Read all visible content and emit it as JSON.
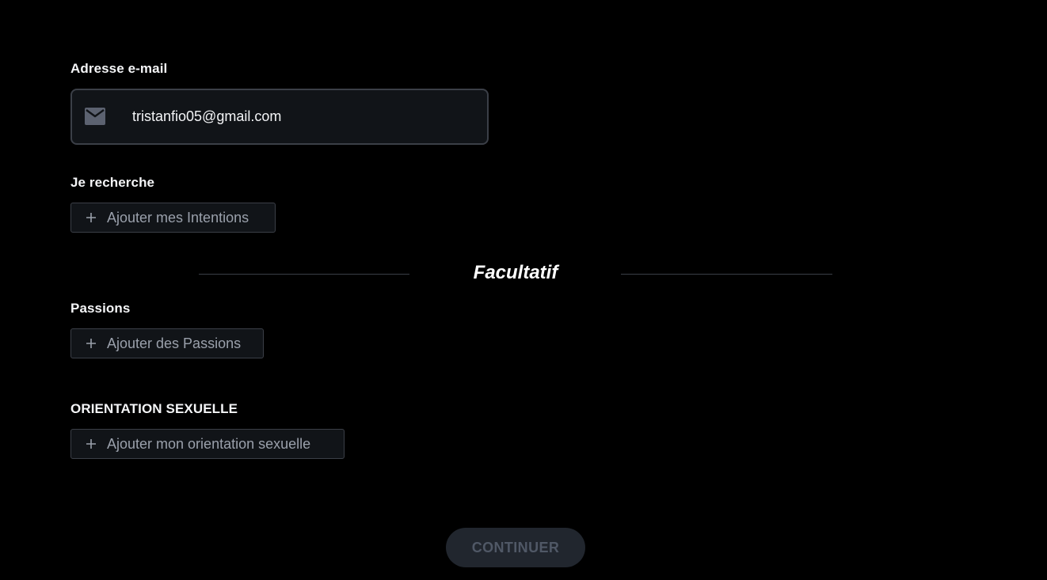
{
  "email": {
    "label": "Adresse e-mail",
    "value": "tristanfio05@gmail.com",
    "icon": "mail-icon"
  },
  "intentions": {
    "label": "Je recherche",
    "button_label": "Ajouter mes Intentions"
  },
  "optional": {
    "title": "Facultatif"
  },
  "passions": {
    "label": "Passions",
    "button_label": "Ajouter des Passions"
  },
  "orientation": {
    "label": "ORIENTATION SEXUELLE",
    "button_label": "Ajouter mon orientation sexuelle"
  },
  "continue": {
    "label": "CONTINUER"
  },
  "colors": {
    "background": "#000000",
    "field_bg": "#111418",
    "border": "#3b3f47",
    "muted_text": "#9aa0ab",
    "disabled_button_bg": "#21262e",
    "disabled_button_text": "#505866"
  }
}
